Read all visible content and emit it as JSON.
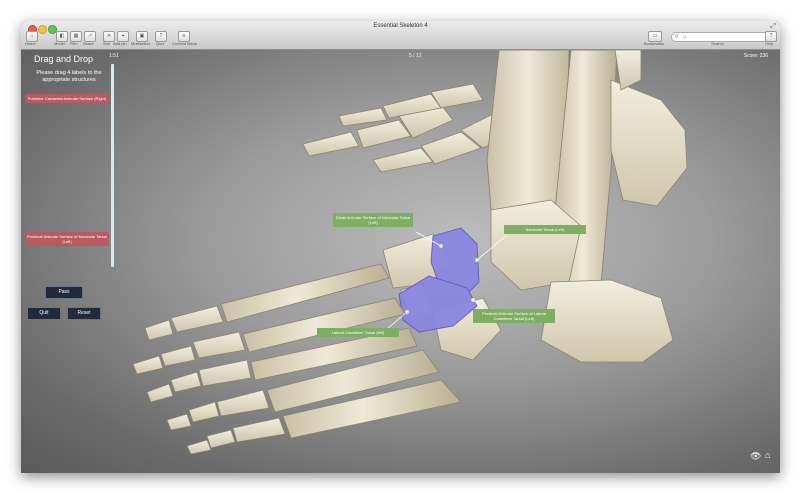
{
  "window": {
    "title": "Essential Skeleton 4"
  },
  "toolbar": {
    "items": [
      {
        "label": "Home",
        "icon": "home-icon"
      },
      {
        "label": "Model",
        "icon": "model-icon"
      },
      {
        "label": "Film",
        "icon": "film-icon"
      },
      {
        "label": "Share",
        "icon": "share-icon"
      },
      {
        "label": "Sun",
        "icon": "sun-icon"
      },
      {
        "label": "Add pin",
        "icon": "pin-icon"
      },
      {
        "label": "Multiselect",
        "icon": "multiselect-icon"
      },
      {
        "label": "Quiz",
        "icon": "quiz-icon"
      },
      {
        "label": "Content Menu",
        "icon": "content-menu-icon"
      }
    ],
    "bookmarks_label": "Bookmarks",
    "search_label": "Search",
    "search_placeholder": "Q-",
    "help_label": "Help"
  },
  "quiz": {
    "title": "Drag and Drop",
    "instructions": "Please drag 4 labels to the appropriate structures",
    "timer": "1:51",
    "progress": "5 / 12",
    "score": "Score: 236",
    "time_remaining_fraction": 1.0,
    "remaining_labels": [
      "Posterior Calcaneal Articular Surface (Right)",
      "Proximal Articular Surface of Navicular Tarsal (Left)"
    ],
    "buttons": {
      "pass": "Pass",
      "quit": "Quit",
      "reset": "Reset"
    },
    "placed_labels": [
      "Distal Articular Surface of Navicular Tarsal (Left)",
      "Navicular Tarsal (Left)",
      "Lateral Cuneiform Tarsal (left)",
      "Proximal Articular Surface of Lateral Cuneiform Tarsal (Left)"
    ]
  },
  "colors": {
    "label_red": "#b85a62",
    "label_green": "#7eae62",
    "highlight_purple": "#8a86e0",
    "bone": "#e6e0cc"
  },
  "corner_icons": [
    "eye-icon",
    "home-icon"
  ]
}
